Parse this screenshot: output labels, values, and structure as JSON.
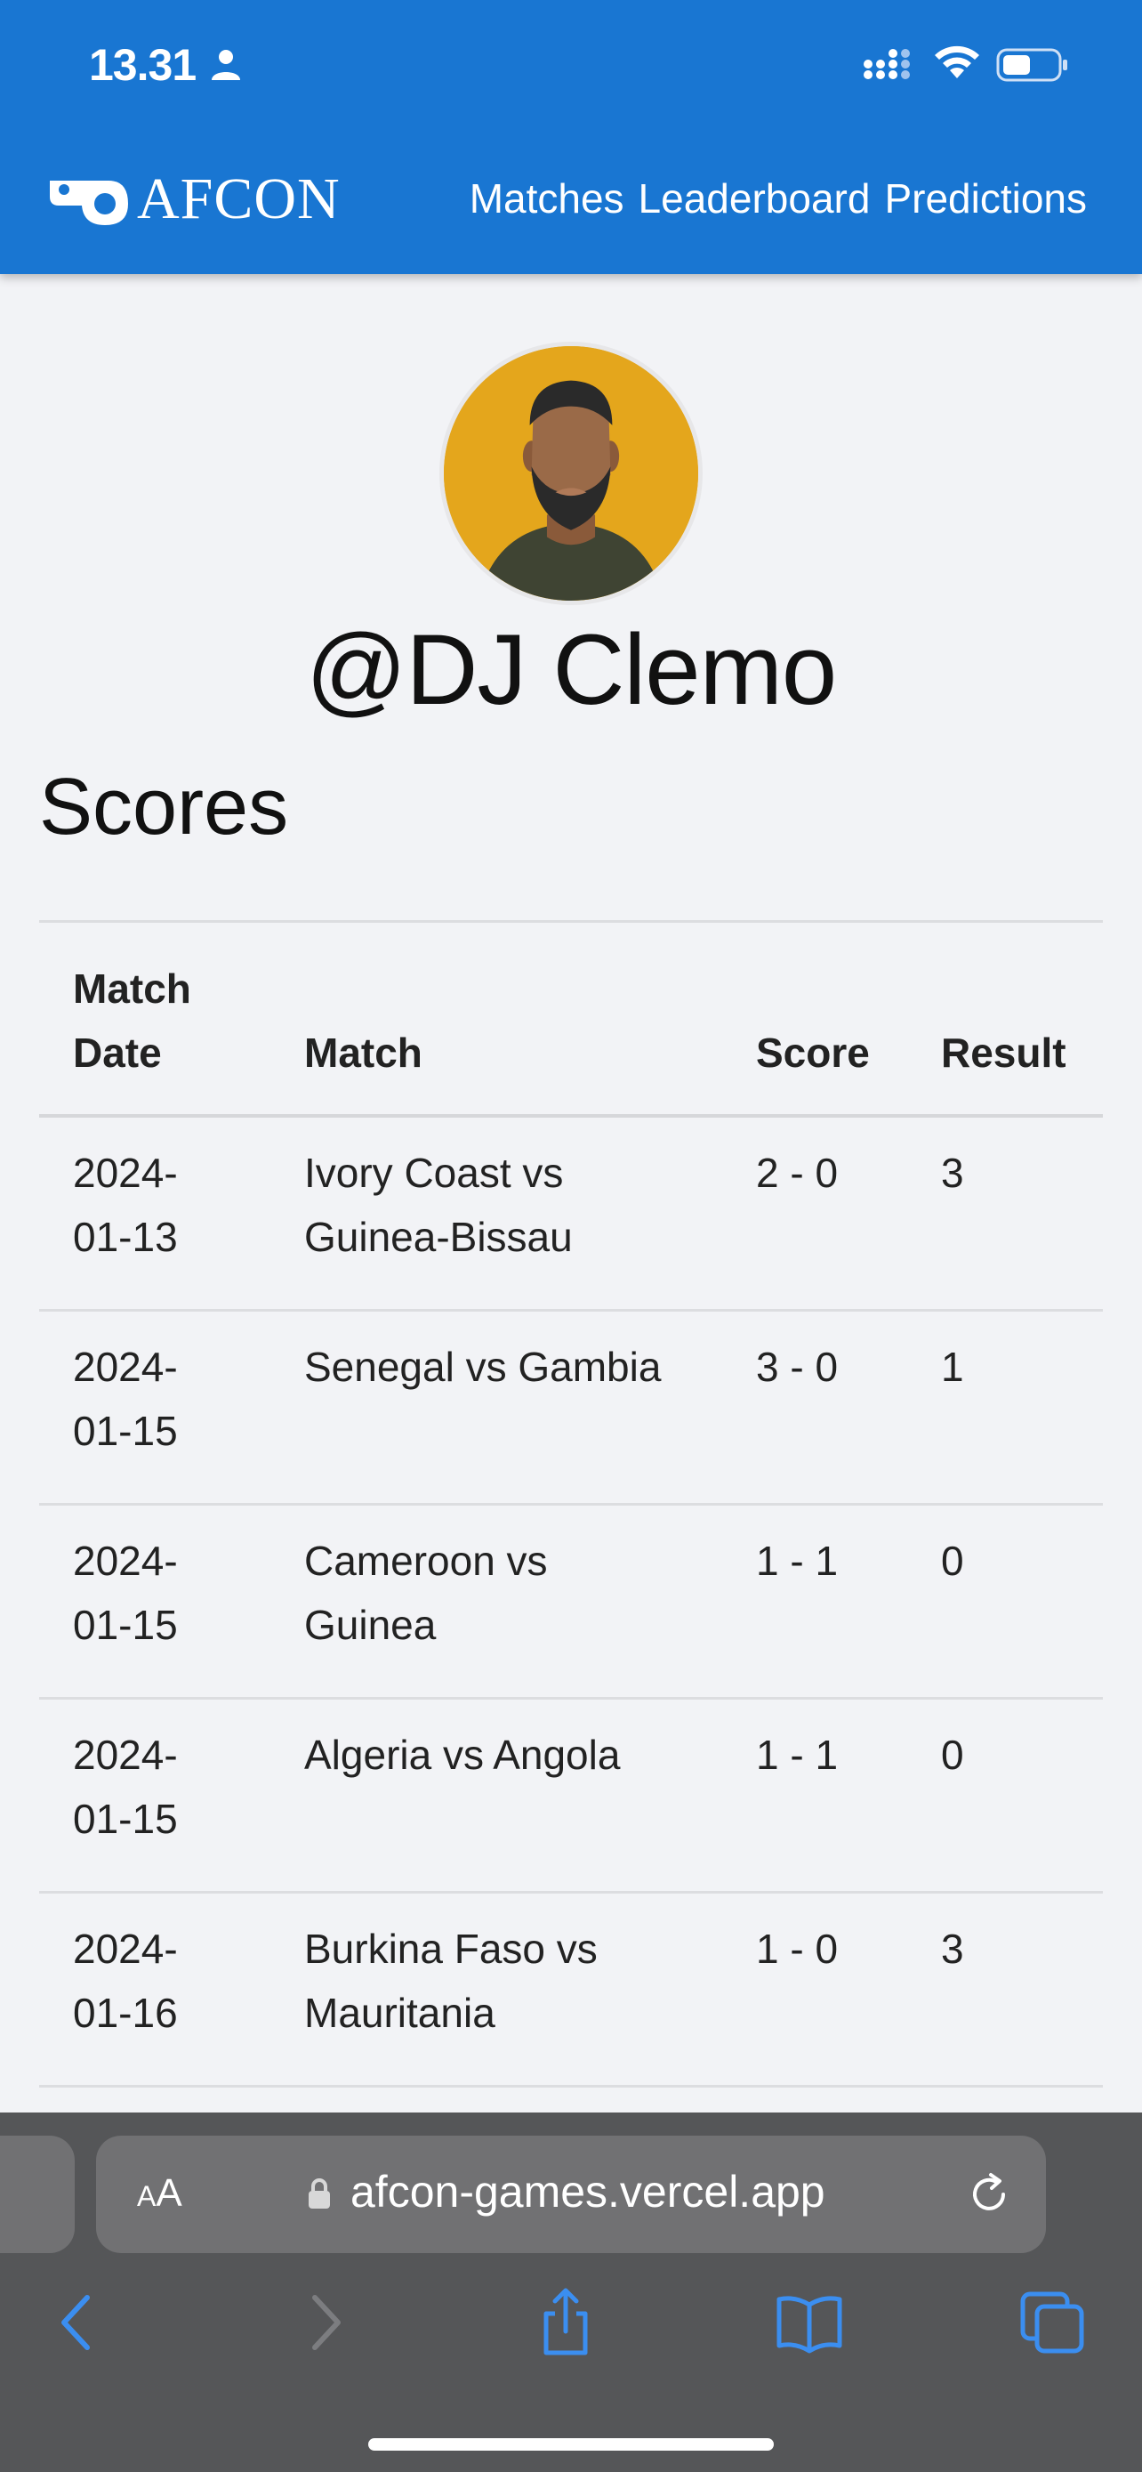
{
  "status_bar": {
    "time": "13.31"
  },
  "header": {
    "brand": "AFCON",
    "nav": [
      "Matches",
      "Leaderboard",
      "Predictions"
    ]
  },
  "profile": {
    "username": "@DJ Clemo"
  },
  "scores": {
    "title": "Scores",
    "columns": [
      "Match Date",
      "Match",
      "Score",
      "Result"
    ],
    "rows": [
      {
        "date_top": "2024-",
        "date_bottom": "01-13",
        "match_top": "Ivory Coast vs",
        "match_bottom": "Guinea-Bissau",
        "score": "2 - 0",
        "result": "3"
      },
      {
        "date_top": "2024-",
        "date_bottom": "01-15",
        "match_top": "Senegal vs Gambia",
        "match_bottom": "",
        "score": "3 - 0",
        "result": "1"
      },
      {
        "date_top": "2024-",
        "date_bottom": "01-15",
        "match_top": "Cameroon vs",
        "match_bottom": "Guinea",
        "score": "1 - 1",
        "result": "0"
      },
      {
        "date_top": "2024-",
        "date_bottom": "01-15",
        "match_top": "Algeria vs Angola",
        "match_bottom": "",
        "score": "1 - 1",
        "result": "0"
      },
      {
        "date_top": "2024-",
        "date_bottom": "01-16",
        "match_top": "Burkina Faso vs",
        "match_bottom": "Mauritania",
        "score": "1 - 0",
        "result": "3"
      }
    ]
  },
  "browser": {
    "aa_label": "AA",
    "url": "afcon-games.vercel.app"
  },
  "colors": {
    "header": "#1976d2",
    "page_bg": "#f2f3f6",
    "avatar_bg": "#e4a61c",
    "chrome_bg": "#555658",
    "toolbar_icon": "#3b8ef0"
  },
  "icons": [
    "person-icon",
    "signal-icon",
    "wifi-icon",
    "battery-icon",
    "whistle-icon",
    "lock-icon",
    "reload-icon",
    "back-icon",
    "forward-icon",
    "share-icon",
    "bookmarks-icon",
    "tabs-icon"
  ]
}
